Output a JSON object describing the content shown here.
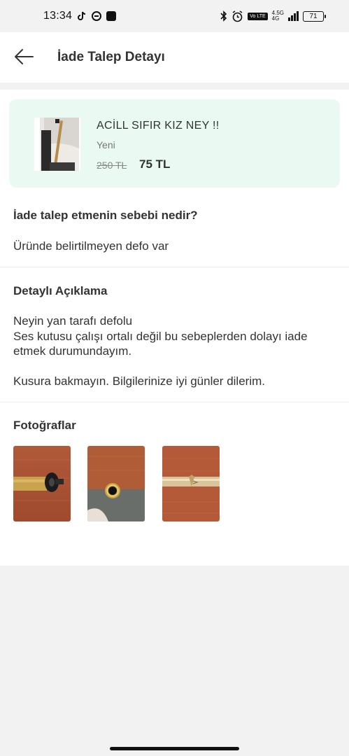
{
  "status_bar": {
    "time": "13:34",
    "network_top": "4.5G",
    "network_bottom": "4G",
    "volte": "Vo LTE",
    "battery": "71"
  },
  "header": {
    "title": "İade Talep Detayı",
    "back_icon": "arrow-left-icon"
  },
  "product": {
    "title": "ACİLL SIFIR KIZ NEY !!",
    "condition": "Yeni",
    "old_price": "250 TL",
    "new_price": "75 TL"
  },
  "reason": {
    "label": "İade talep etmenin sebebi nedir?",
    "value": "Üründe belirtilmeyen defo var"
  },
  "details": {
    "label": "Detaylı Açıklama",
    "lines": [
      "Neyin yan tarafı defolu",
      "Ses kutusu çalışı ortalı değil bu sebeplerden dolayı iade etmek durumundayım.",
      "",
      "Kusura bakmayın. Bilgilerinize iyi günler dilerim."
    ]
  },
  "photos": {
    "label": "Fotoğraflar",
    "count": 3
  },
  "colors": {
    "card_bg": "#eafaf3",
    "wood": "#b55a38",
    "page_bg": "#f2f2f2"
  }
}
